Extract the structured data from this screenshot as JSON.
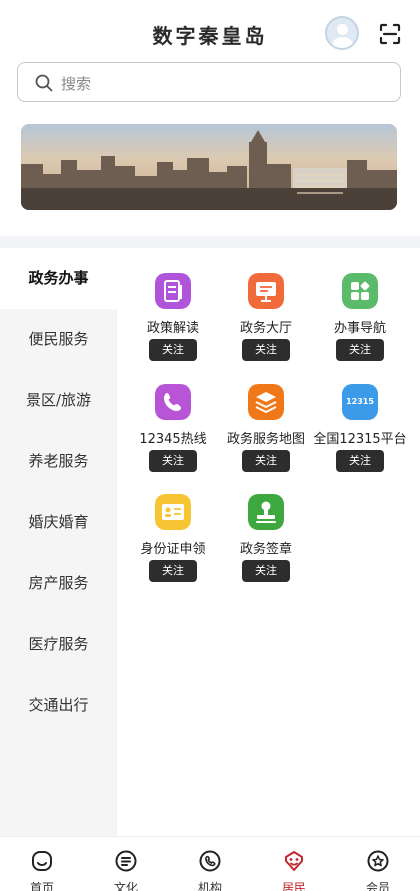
{
  "header": {
    "title": "数字秦皇岛",
    "avatar_icon": "avatar-icon",
    "scan_icon": "scan-icon"
  },
  "search": {
    "placeholder": "搜索",
    "icon": "search-icon"
  },
  "sidebar": {
    "items": [
      {
        "label": "政务办事",
        "active": true
      },
      {
        "label": "便民服务"
      },
      {
        "label": "景区/旅游"
      },
      {
        "label": "养老服务"
      },
      {
        "label": "婚庆婚育"
      },
      {
        "label": "房产服务"
      },
      {
        "label": "医疗服务"
      },
      {
        "label": "交通出行"
      }
    ]
  },
  "services": [
    {
      "label": "政策解读",
      "button": "关注",
      "icon": "document-icon",
      "color": "#b055d9"
    },
    {
      "label": "政务大厅",
      "button": "关注",
      "icon": "monitor-icon",
      "color": "#f06a3a"
    },
    {
      "label": "办事导航",
      "button": "关注",
      "icon": "grid-icon",
      "color": "#5cbb6a"
    },
    {
      "label": "12345热线",
      "button": "关注",
      "icon": "phone-icon",
      "color": "#b755d6"
    },
    {
      "label": "政务服务地图",
      "button": "关注",
      "icon": "layers-icon",
      "color": "#f07818"
    },
    {
      "label": "全国12315平台",
      "button": "关注",
      "icon": "badge-12315-icon",
      "badge_text": "12315",
      "color": "#3c9be8"
    },
    {
      "label": "身份证申领",
      "button": "关注",
      "icon": "id-card-icon",
      "color": "#f6c534"
    },
    {
      "label": "政务签章",
      "button": "关注",
      "icon": "stamp-icon",
      "color": "#3ea83e"
    }
  ],
  "tabbar": {
    "items": [
      {
        "label": "首页",
        "icon": "home-icon"
      },
      {
        "label": "文化",
        "icon": "list-icon"
      },
      {
        "label": "机构",
        "icon": "phone-circle-icon"
      },
      {
        "label": "居民",
        "icon": "residents-icon",
        "active": true
      },
      {
        "label": "会员",
        "icon": "member-icon"
      }
    ]
  },
  "colors": {
    "accent": "#c2272d",
    "sidebar_bg": "#f5f5f5",
    "button_bg": "#2d2d2d"
  }
}
